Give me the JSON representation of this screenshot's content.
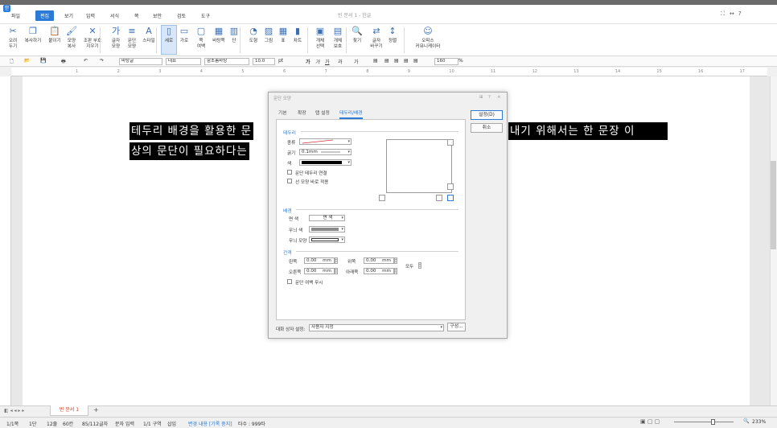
{
  "window": {
    "title": "빈 문서 1 - 한글"
  },
  "menu": {
    "file": "파일",
    "items": [
      "편집",
      "보기",
      "입력",
      "서식",
      "쪽",
      "보안",
      "검토",
      "도구"
    ],
    "right": [
      "⛶",
      "↔",
      "?"
    ]
  },
  "ribbon": {
    "items": [
      "오려\n두기",
      "복사하기",
      "붙이기",
      "모양\n복사",
      "조판 부호\n지우기",
      "글자\n모양",
      "문단\n모양",
      "스타일",
      "세로",
      "가로",
      "쪽\n여백",
      "바탕쪽",
      "단",
      "도형",
      "그림",
      "표",
      "차트",
      "개체\n선택",
      "개체\n보호",
      "찾기",
      "글자\n바꾸기",
      "정렬",
      "오피스\n커뮤니케이터"
    ]
  },
  "formatbar": {
    "style": "바탕글",
    "lang": "대표",
    "font": "함초롬바탕",
    "size": "10.0",
    "unit": "pt",
    "glyphs": [
      "가",
      "가",
      "가",
      "과",
      "가"
    ],
    "zoom": "160",
    "zoom_unit": "%"
  },
  "ruler": {
    "ticks": [
      "1",
      "2",
      "3",
      "4",
      "5",
      "6",
      "7",
      "8",
      "9",
      "10",
      "11",
      "12",
      "13",
      "14",
      "15",
      "16",
      "17"
    ]
  },
  "document": {
    "line1_left": "테두리 배경을 활용한 문",
    "line1_right": "내기 위해서는 한 문장 이",
    "line2": "상의 문단이 필요하다는"
  },
  "dialog": {
    "title": "문단 모양",
    "title_icons": [
      "⊞",
      "?",
      "×"
    ],
    "tabs": [
      "기본",
      "확장",
      "탭 설정",
      "테두리/배경"
    ],
    "active_tab": "테두리/배경",
    "border_section": "테두리",
    "type_label": "종류",
    "thickness_label": "굵기",
    "thickness_value": "0.1mm",
    "color_label": "색",
    "connect_border": "문단 테두리 연결",
    "apply_line": "선 모양 바로 적용",
    "bg_section": "배경",
    "face_color_label": "면 색",
    "face_color_value": "면 색",
    "pattern_color_label": "무늬 색",
    "pattern_shape_label": "무늬 모양",
    "spacing_section": "간격",
    "left_label": "왼쪽",
    "right_label": "오른쪽",
    "top_label": "위쪽",
    "bottom_label": "아래쪽",
    "left_value": "0.00",
    "right_value": "0.00",
    "top_value": "0.00",
    "bottom_value": "0.00",
    "mm": "mm",
    "all_label": "모두",
    "ignore_margin": "문단 여백 무시",
    "dlg_setting_label": "대화 상자 설정:",
    "dlg_setting_value": "사용자 지정",
    "compose_button": "구성...",
    "ok_button": "설정(D)",
    "cancel_button": "취소"
  },
  "tabs": {
    "doc": "빈 문서 1",
    "add": "+"
  },
  "status": [
    "1/1쪽",
    "1단",
    "12줄",
    "60칸",
    "85/112글자",
    "문자 입력",
    "1/1 구역",
    "삽입",
    "변경 내용 [기록 중지]",
    "타수 : 999타"
  ],
  "zoom_status": "233%",
  "colors": {
    "accent": "#2b7bd6",
    "doc_tab": "#d9402b",
    "status_highlight": "#2b7bd6"
  }
}
